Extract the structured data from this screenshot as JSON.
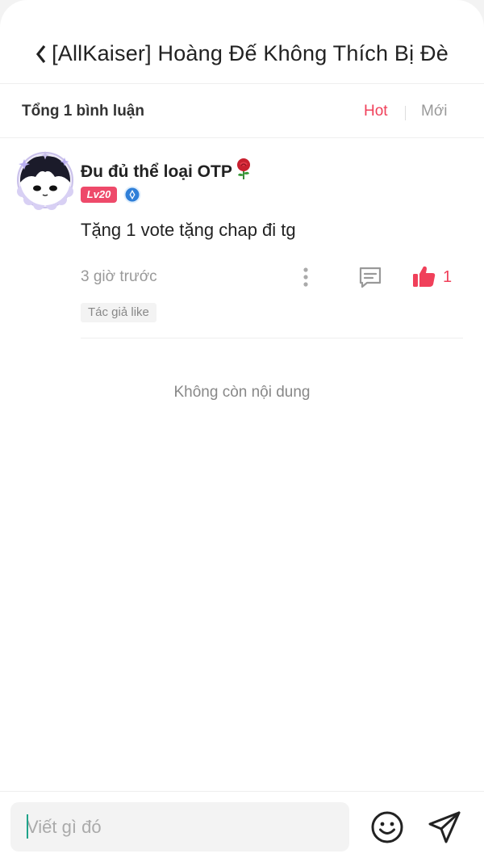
{
  "header": {
    "back_icon": "chevron-left-icon",
    "title": "[AllKaiser] Hoàng Đế Không Thích Bị Đè"
  },
  "sort_bar": {
    "total_label": "Tổng 1 bình luận",
    "tabs": [
      {
        "label": "Hot",
        "active": true
      },
      {
        "label": "Mới",
        "active": false
      }
    ]
  },
  "comments": [
    {
      "username": "Đu đủ thể loại OTP",
      "username_icon": "rose-icon",
      "level_badge": "Lv20",
      "verified_icon": "verified-badge-icon",
      "text": "Tặng 1 vote tặng chap đi tg",
      "time": "3 giờ trước",
      "like_count": "1",
      "liked": true,
      "author_tag": "Tác giả like"
    }
  ],
  "end_text": "Không còn nội dung",
  "footer": {
    "input_placeholder": "Viết gì đó",
    "emoji_icon": "smiley-icon",
    "send_icon": "send-icon"
  },
  "colors": {
    "accent": "#f0405a",
    "level_badge": "#ee4a6a",
    "verified": "#2f7fd8",
    "muted_text": "#999999"
  }
}
